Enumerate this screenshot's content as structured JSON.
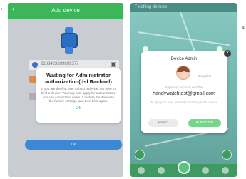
{
  "left_screen": {
    "header": {
      "back_icon": "back-arrow-icon",
      "title": "Add device"
    },
    "device_id_field": {
      "value": "2188423399899577",
      "scan_icon": "scan-icon"
    },
    "dialog": {
      "title": "Waiting for Administrator authorization(dsl Rachael)",
      "body": "If you are the first user to bind a device, tap here to bind a device. You may also apply for authorization, you can contact the seller to restore the device to the factory settings, and then bind again.",
      "ok_label": "Ok"
    },
    "bottom_button_label": "Ok",
    "accent_color": "#3db55a"
  },
  "right_screen": {
    "top_label": "Fetching devices",
    "dialog": {
      "title": "Device Admin",
      "relation": "Daughter",
      "subtitle": "Applicant account number",
      "email": "handywatchtest@gmail.com",
      "note": "To apply for user authority to manage this device",
      "reject_label": "Reject",
      "accept_label": "Authorized",
      "close_icon": "close-icon",
      "avatar_icon": "avatar-girl-icon"
    },
    "accent_color": "#78d48a"
  }
}
